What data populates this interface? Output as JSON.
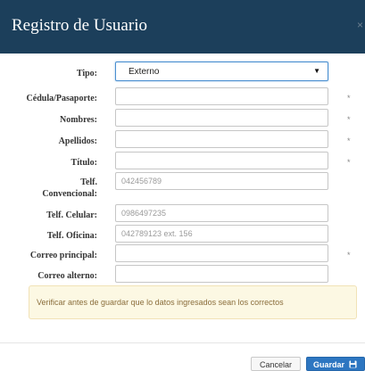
{
  "modal": {
    "title": "Registro de Usuario",
    "close_glyph": "×"
  },
  "form": {
    "tipo": {
      "label": "Tipo:",
      "value": "Externo"
    },
    "cedula": {
      "label": "Cédula/Pasaporte:",
      "value": "",
      "placeholder": "",
      "required_mark": "*"
    },
    "nombres": {
      "label": "Nombres:",
      "value": "",
      "placeholder": "",
      "required_mark": "*"
    },
    "apellidos": {
      "label": "Apellidos:",
      "value": "",
      "placeholder": "",
      "required_mark": "*"
    },
    "titulo": {
      "label": "Título:",
      "value": "",
      "placeholder": "",
      "required_mark": "*"
    },
    "telf_convencional": {
      "label_line1": "Telf.",
      "label_line2": "Convencional:",
      "value": "",
      "placeholder": "042456789"
    },
    "telf_celular": {
      "label": "Telf. Celular:",
      "value": "",
      "placeholder": "0986497235"
    },
    "telf_oficina": {
      "label": "Telf. Oficina:",
      "value": "",
      "placeholder": "042789123 ext. 156"
    },
    "correo_principal": {
      "label": "Correo principal:",
      "value": "",
      "placeholder": "",
      "required_mark": "*"
    },
    "correo_alterno": {
      "label": "Correo alterno:",
      "value": "",
      "placeholder": ""
    }
  },
  "alert": {
    "text": "Verificar antes de guardar que lo datos ingresados sean los correctos"
  },
  "footer": {
    "cancel_label": "Cancelar",
    "save_label": "Guardar"
  },
  "colors": {
    "header_bg": "#1c3f5b",
    "primary": "#2d76c1",
    "warning_bg": "#fcf8e3",
    "warning_text": "#8a6d3b"
  },
  "icons": {
    "save": "floppy-disk-icon",
    "caret": "caret-down-icon",
    "close": "close-icon"
  }
}
